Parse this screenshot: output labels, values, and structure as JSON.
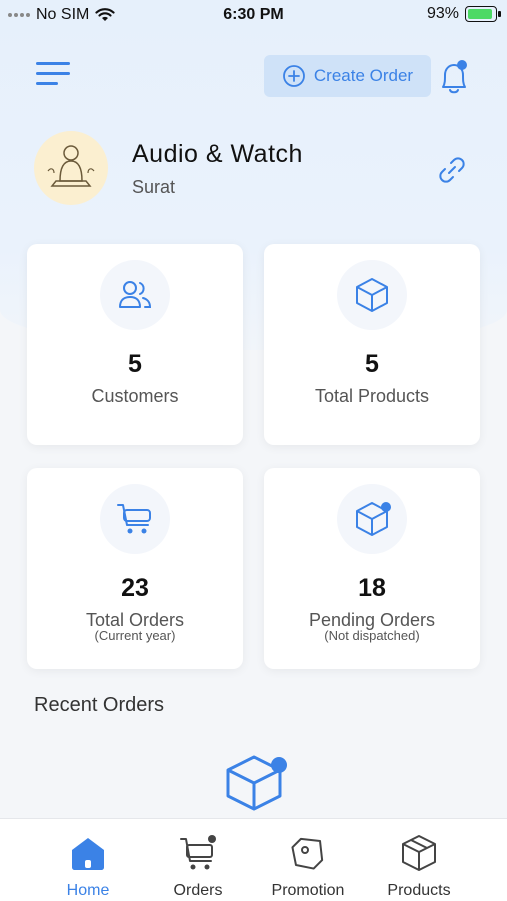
{
  "status_bar": {
    "carrier": "No SIM",
    "time": "6:30 PM",
    "battery": "93%"
  },
  "header": {
    "create_order_label": "Create Order"
  },
  "store": {
    "name": "Audio & Watch",
    "city": "Surat"
  },
  "stats": [
    {
      "value": "5",
      "label": "Customers",
      "sub": ""
    },
    {
      "value": "5",
      "label": "Total Products",
      "sub": ""
    },
    {
      "value": "23",
      "label": "Total Orders",
      "sub": "(Current year)"
    },
    {
      "value": "18",
      "label": "Pending Orders",
      "sub": "(Not dispatched)"
    }
  ],
  "recent_orders": {
    "title": "Recent Orders"
  },
  "tabs": [
    {
      "label": "Home",
      "icon": "home-icon",
      "active": true
    },
    {
      "label": "Orders",
      "icon": "cart-icon",
      "active": false
    },
    {
      "label": "Promotion",
      "icon": "tag-icon",
      "active": false
    },
    {
      "label": "Products",
      "icon": "box-icon",
      "active": false
    }
  ],
  "colors": {
    "accent": "#3b82e6",
    "accent_light": "#cfe2f8",
    "battery": "#4cd964"
  }
}
